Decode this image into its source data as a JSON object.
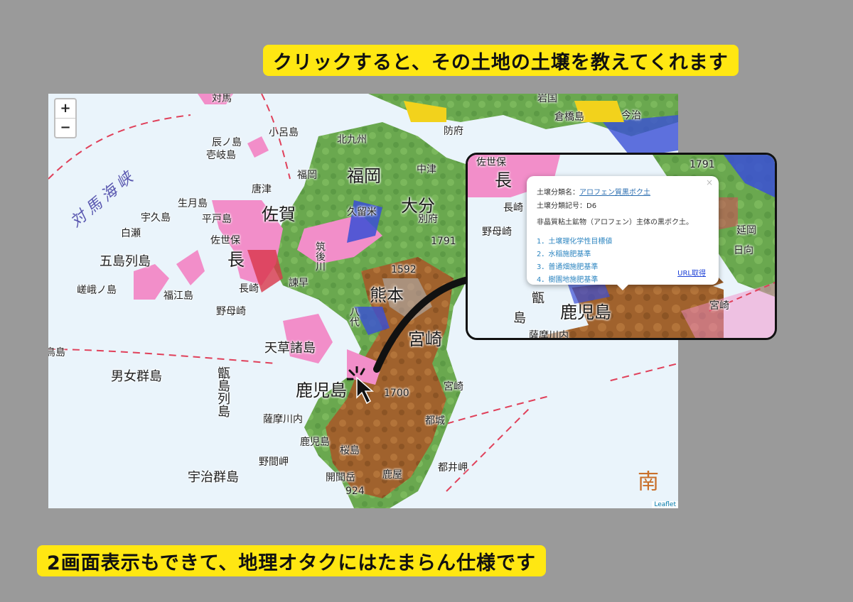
{
  "banners": {
    "top": "クリックすると、その土地の土壌を教えてくれます",
    "bottom": "2画面表示もできて、地理オタクにはたまらん仕様です"
  },
  "map": {
    "zoom_in": "+",
    "zoom_out": "−",
    "attribution": "Leaflet",
    "labels": {
      "tsushima": "対馬",
      "tsushima_strait": "対馬海峡",
      "iki": "辰ノ島",
      "ikishima": "壱岐島",
      "koro": "小呂島",
      "kitakyushu": "北九州",
      "hofu": "防府",
      "iwakuni": "岩国",
      "kurahashi": "倉橋島",
      "imabari": "今治",
      "nakatsu": "中津",
      "fukuoka_city": "福岡",
      "fukuoka_pref": "福岡",
      "karatsu": "唐津",
      "kurume": "久留米",
      "oita": "大分",
      "beppu": "別府",
      "saga": "佐賀",
      "ikitsuki": "生月島",
      "hirado": "平戸島",
      "ukushima": "宇久島",
      "shirase": "白瀬",
      "sasebo": "佐世保",
      "nagasaki_pref": "長",
      "nagasaki_city": "長崎",
      "goto": "五島列島",
      "sagano": "嵯峨ノ島",
      "fukue": "福江島",
      "nomozaki": "野母崎",
      "isahaya": "諫早",
      "kumamoto": "熊本",
      "miyazaki_pref": "宮崎",
      "amakusa": "天草諸島",
      "danjo": "男女群島",
      "torishima": "鳥島",
      "kagoshima_pref": "鹿児島",
      "miyazaki_city": "宮崎",
      "koshiki": "甑島列島",
      "satsumasendai": "薩摩川内",
      "kagoshima_city": "鹿児島",
      "sakurajima": "桜島",
      "miyakonojo": "都城",
      "nomamisaki": "野間岬",
      "kanoya": "鹿屋",
      "toi": "都井岬",
      "uji": "宇治群島",
      "kaimon": "開聞岳",
      "minami": "南",
      "peak1791": "1791",
      "peak1700": "1700",
      "peak1592": "1592",
      "peak924": "924",
      "chikugo": "筑後川",
      "kurokami": "八代"
    }
  },
  "inset": {
    "labels": {
      "sasebo": "佐世保",
      "nagasaki": "長",
      "nagasaki_city": "長崎",
      "nomozaki": "野母崎",
      "nobeoka": "延岡",
      "hyuga": "日向",
      "koshiki": "甑",
      "koshiki2": "島",
      "kagoshima": "鹿児島",
      "miyazaki": "宮崎",
      "satsuma": "薩摩川内",
      "peak": "1791"
    },
    "popup": {
      "close": "×",
      "soil_name_label": "土壌分類名：",
      "soil_name_value": "アロフェン質黒ボク土",
      "soil_code_label": "土壌分類記号：",
      "soil_code_value": "D6",
      "description": "非晶質粘土鉱物（アロフェン）主体の黒ボク土。",
      "links": [
        "1．土壌理化学性目標値",
        "2．水稲施肥基準",
        "3．普通畑施肥基準",
        "4．樹園地施肥基準"
      ],
      "url_button": "URL取得"
    }
  },
  "colors": {
    "banner": "#ffe712",
    "sea": "#eaf4fb",
    "forest": "#6aa84f",
    "andosol": "#a0622d",
    "pink": "#f28ec9",
    "blue": "#3a4fd6",
    "red_dash": "#e0405a"
  }
}
